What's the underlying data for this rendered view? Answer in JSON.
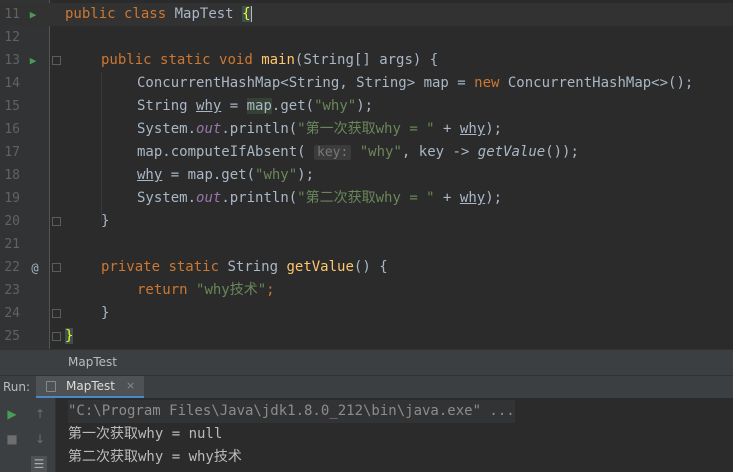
{
  "editor": {
    "lines": [
      {
        "num": "11",
        "text": "public class MapTest {"
      },
      {
        "num": "12",
        "text": ""
      },
      {
        "num": "13",
        "text": "public static void main(String[] args) {"
      },
      {
        "num": "14",
        "text": "ConcurrentHashMap<String, String> map = new ConcurrentHashMap<>();"
      },
      {
        "num": "15",
        "text": "String why = map.get(\"why\");"
      },
      {
        "num": "16",
        "text": "System.out.println(\"第一次获取why = \" + why);"
      },
      {
        "num": "17",
        "text": "map.computeIfAbsent( key: \"why\", key -> getValue());"
      },
      {
        "num": "18",
        "text": "why = map.get(\"why\");"
      },
      {
        "num": "19",
        "text": "System.out.println(\"第二次获取why = \" + why);"
      },
      {
        "num": "20",
        "text": "}"
      },
      {
        "num": "21",
        "text": ""
      },
      {
        "num": "22",
        "text": "private static String getValue() {"
      },
      {
        "num": "23",
        "text": "return \"why技术\";"
      },
      {
        "num": "24",
        "text": "}"
      },
      {
        "num": "25",
        "text": "}"
      }
    ],
    "tokens": {
      "kw_public": "public",
      "kw_class": "class",
      "class_name": "MapTest",
      "brace_open": "{",
      "kw_public2": "public",
      "kw_static": "static",
      "kw_void": "void",
      "fn_main": "main",
      "main_params": "(String[] args) {",
      "l14_a": "ConcurrentHashMap<String, String> map = ",
      "kw_new": "new",
      "l14_b": " ConcurrentHashMap<>();",
      "l15_a": "String ",
      "l15_why": "why",
      "l15_b": " = ",
      "l15_map": "map",
      "l15_c": ".get(",
      "l15_str": "\"why\"",
      "l15_d": ");",
      "l16_a": "System.",
      "l16_out": "out",
      "l16_b": ".println(",
      "l16_str": "\"第一次获取why = \"",
      "l16_c": " + ",
      "l16_why": "why",
      "l16_d": ");",
      "l17_a": "map.computeIfAbsent( ",
      "l17_hint": "key:",
      "l17_str": " \"why\"",
      "l17_b": ", key -> ",
      "l17_fn": "getValue",
      "l17_c": "());",
      "l18_why": "why",
      "l18_a": " = map.get(",
      "l18_str": "\"why\"",
      "l18_b": ");",
      "l19_a": "System.",
      "l19_out": "out",
      "l19_b": ".println(",
      "l19_str": "\"第二次获取why = \"",
      "l19_c": " + ",
      "l19_why": "why",
      "l19_d": ");",
      "l20": "}",
      "kw_private": "private",
      "kw_static2": "static",
      "l22_type": " String ",
      "fn_getvalue": "getValue",
      "l22_b": "() {",
      "kw_return": "return",
      "l23_str": "\"why技术\"",
      "l23_semi": ";",
      "l24": "}",
      "l25": "}"
    },
    "gutter_icons": {
      "run": "▶",
      "override": "@"
    }
  },
  "breadcrumb": {
    "text": "MapTest"
  },
  "run_panel": {
    "label": "Run:",
    "tab_label": "MapTest",
    "tab_close": "×",
    "console_lines": [
      "\"C:\\Program Files\\Java\\jdk1.8.0_212\\bin\\java.exe\" ...",
      "第一次获取why = null",
      "第二次获取why = why技术"
    ],
    "toolbar_icons": {
      "rerun": "▶",
      "up": "↑",
      "stop": "■",
      "down": "↓",
      "wrap": "☰"
    }
  }
}
